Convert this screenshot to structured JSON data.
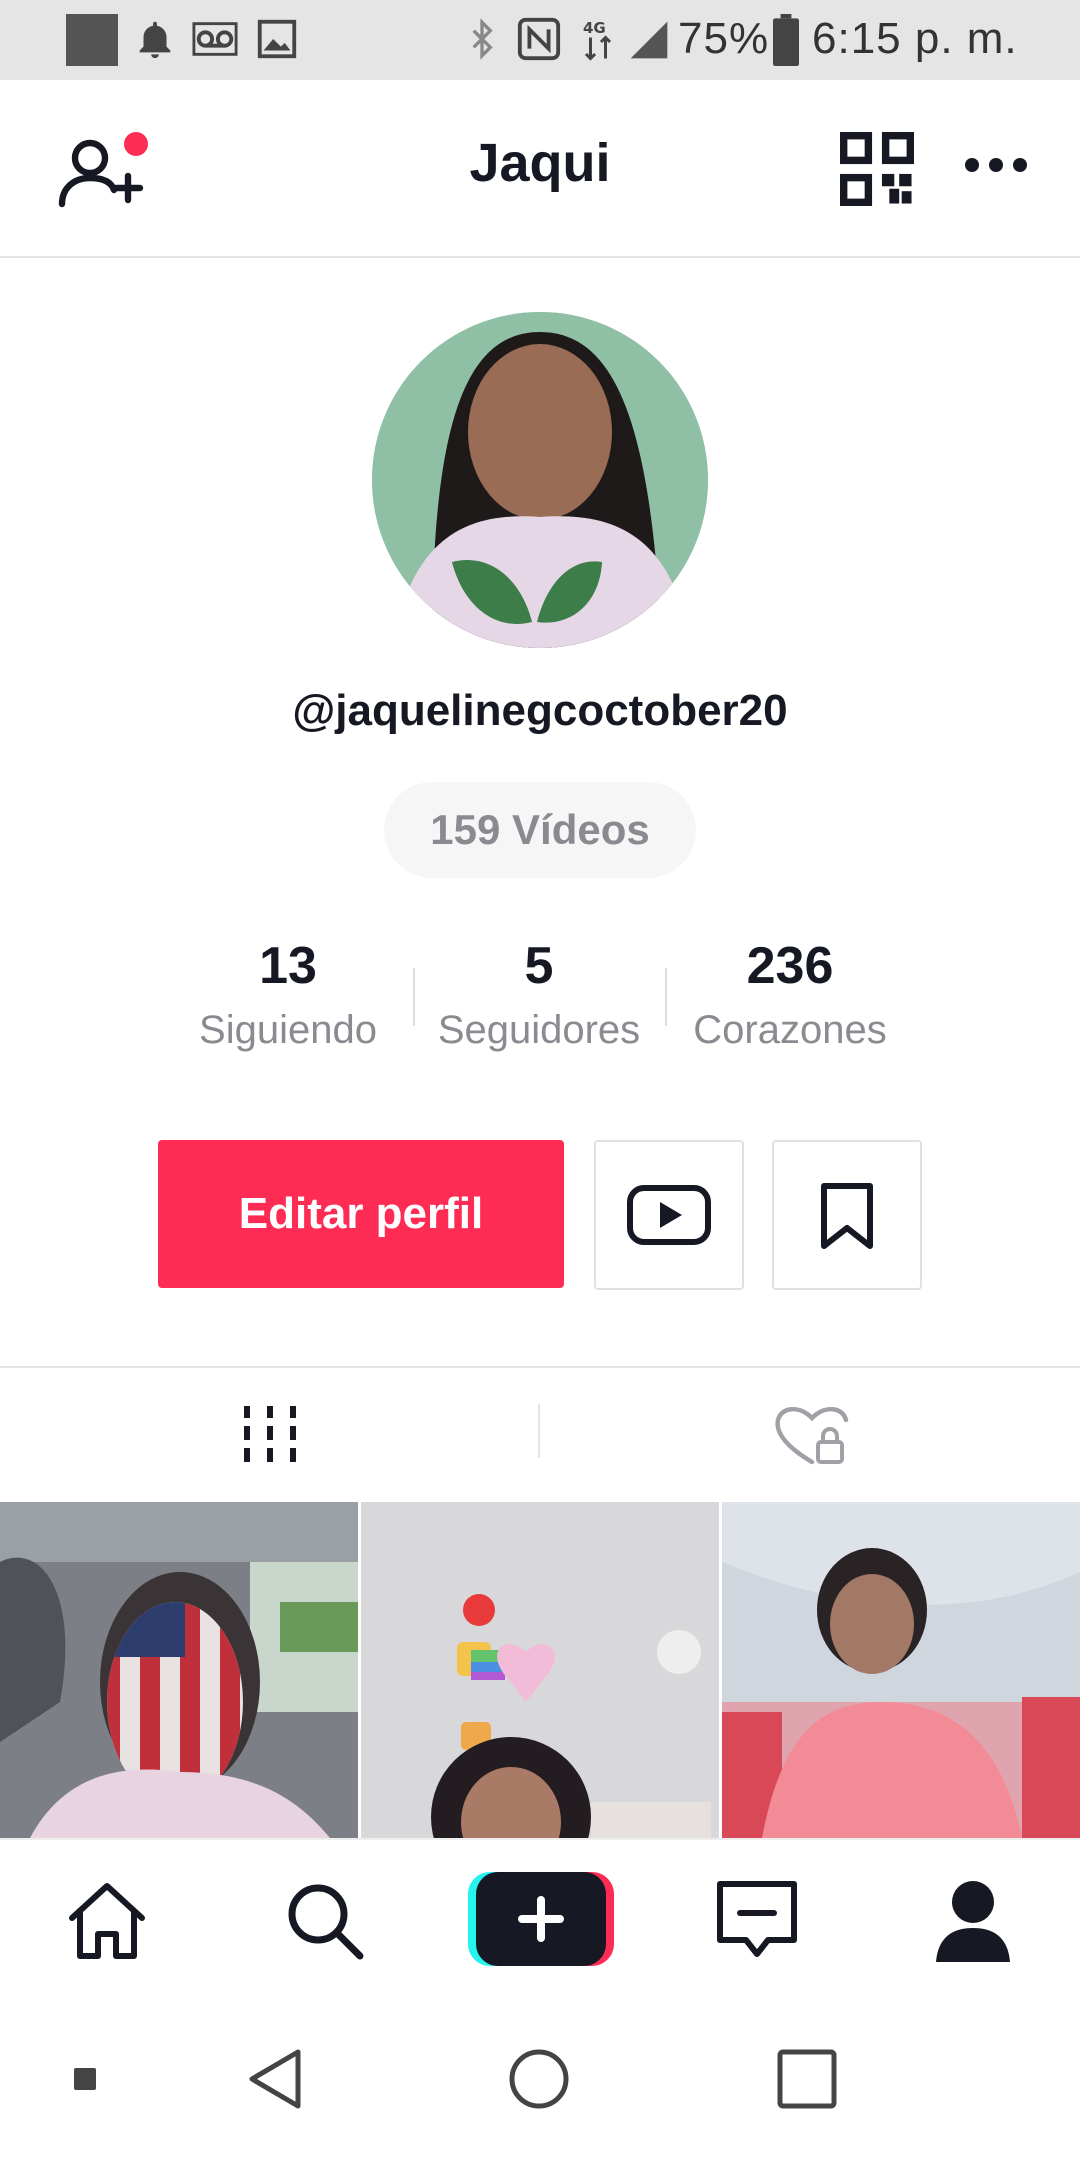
{
  "status_bar": {
    "battery": "75%",
    "time": "6:15 p. m."
  },
  "header": {
    "title": "Jaqui",
    "icons": [
      "add-friend-icon",
      "qr-code-icon",
      "more-icon"
    ]
  },
  "profile": {
    "handle": "@jaquelinegcoctober20",
    "videos_label": "159 Vídeos",
    "stats": [
      {
        "value": "13",
        "label": "Siguiendo"
      },
      {
        "value": "5",
        "label": "Seguidores"
      },
      {
        "value": "236",
        "label": "Corazones"
      }
    ],
    "edit_button": "Editar perfil"
  },
  "tabs": [
    "videos-grid-icon",
    "liked-private-icon"
  ],
  "bottom_nav": [
    "home-icon",
    "search-icon",
    "create-icon",
    "inbox-icon",
    "profile-icon"
  ],
  "colors": {
    "accent": "#fe2c55",
    "cyan": "#25f4ee"
  }
}
